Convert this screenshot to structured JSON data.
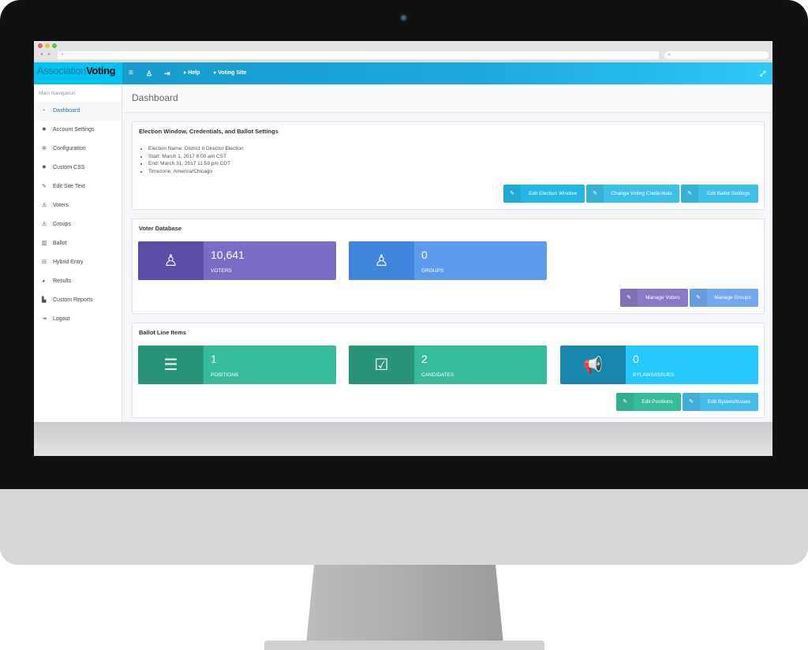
{
  "colors": {
    "header": "#1aa9dc",
    "logo_bg": "#00c2f3",
    "purple": "#7468bf",
    "blue": "#5d9cec",
    "green": "#37bc9b",
    "cyan": "#26c8ff",
    "button_cyan": "#3cc0e8"
  },
  "browser": {
    "address_placeholder": "+",
    "nav": [
      "◂",
      "▸"
    ]
  },
  "logo": {
    "part1": "Association",
    "part2": "Voting"
  },
  "header": {
    "menu_icon": "bars-icon",
    "user_icon": "user-icon",
    "logout_icon": "sign-out-icon",
    "help": "Help",
    "voting_site": "Voting Site",
    "expand_icon": "expand-icon"
  },
  "sidebar": {
    "title": "Main Navigation",
    "items": [
      {
        "label": "Dashboard",
        "icon": "dashboard-icon"
      },
      {
        "label": "Account Settings",
        "icon": "gear-icon"
      },
      {
        "label": "Configuration",
        "icon": "gears-icon"
      },
      {
        "label": "Custom CSS",
        "icon": "gear-icon"
      },
      {
        "label": "Edit Site Text",
        "icon": "pencil-icon"
      },
      {
        "label": "Voters",
        "icon": "user-icon"
      },
      {
        "label": "Groups",
        "icon": "users-icon"
      },
      {
        "label": "Ballot",
        "icon": "book-icon"
      },
      {
        "label": "Hybrid Entry",
        "icon": "car-icon"
      },
      {
        "label": "Results",
        "icon": "pie-chart-icon"
      },
      {
        "label": "Custom Reports",
        "icon": "bar-chart-icon"
      },
      {
        "label": "Logout",
        "icon": "sign-out-icon"
      }
    ]
  },
  "page_title": "Dashboard",
  "election": {
    "title": "Election Window, Credentials, and Ballot Settings",
    "details": [
      "Election Name: District II Director Election",
      "Start: March 1, 2017 8:00 am CST",
      "End: March 31, 2017 11:59 pm CDT",
      "Timezone: America/Chicago"
    ],
    "buttons": [
      "Edit Election Window",
      "Change Voting Credentials",
      "Edit Ballot Settings"
    ]
  },
  "voters": {
    "title": "Voter Database",
    "boxes": [
      {
        "value": "10,641",
        "label": "VOTERS",
        "icon": "user-icon"
      },
      {
        "value": "0",
        "label": "GROUPS",
        "icon": "users-icon"
      }
    ],
    "buttons": [
      "Manage Voters",
      "Manage Groups"
    ]
  },
  "ballot": {
    "title": "Ballot Line Items",
    "boxes": [
      {
        "value": "1",
        "label": "POSITIONS",
        "icon": "list-icon"
      },
      {
        "value": "2",
        "label": "CANDIDATES",
        "icon": "check-square-icon"
      },
      {
        "value": "0",
        "label": "BYLAWS/ISSUES",
        "icon": "bullhorn-icon"
      }
    ],
    "buttons": [
      "Edit Positions",
      "Edit Bylaws/Issues"
    ]
  }
}
